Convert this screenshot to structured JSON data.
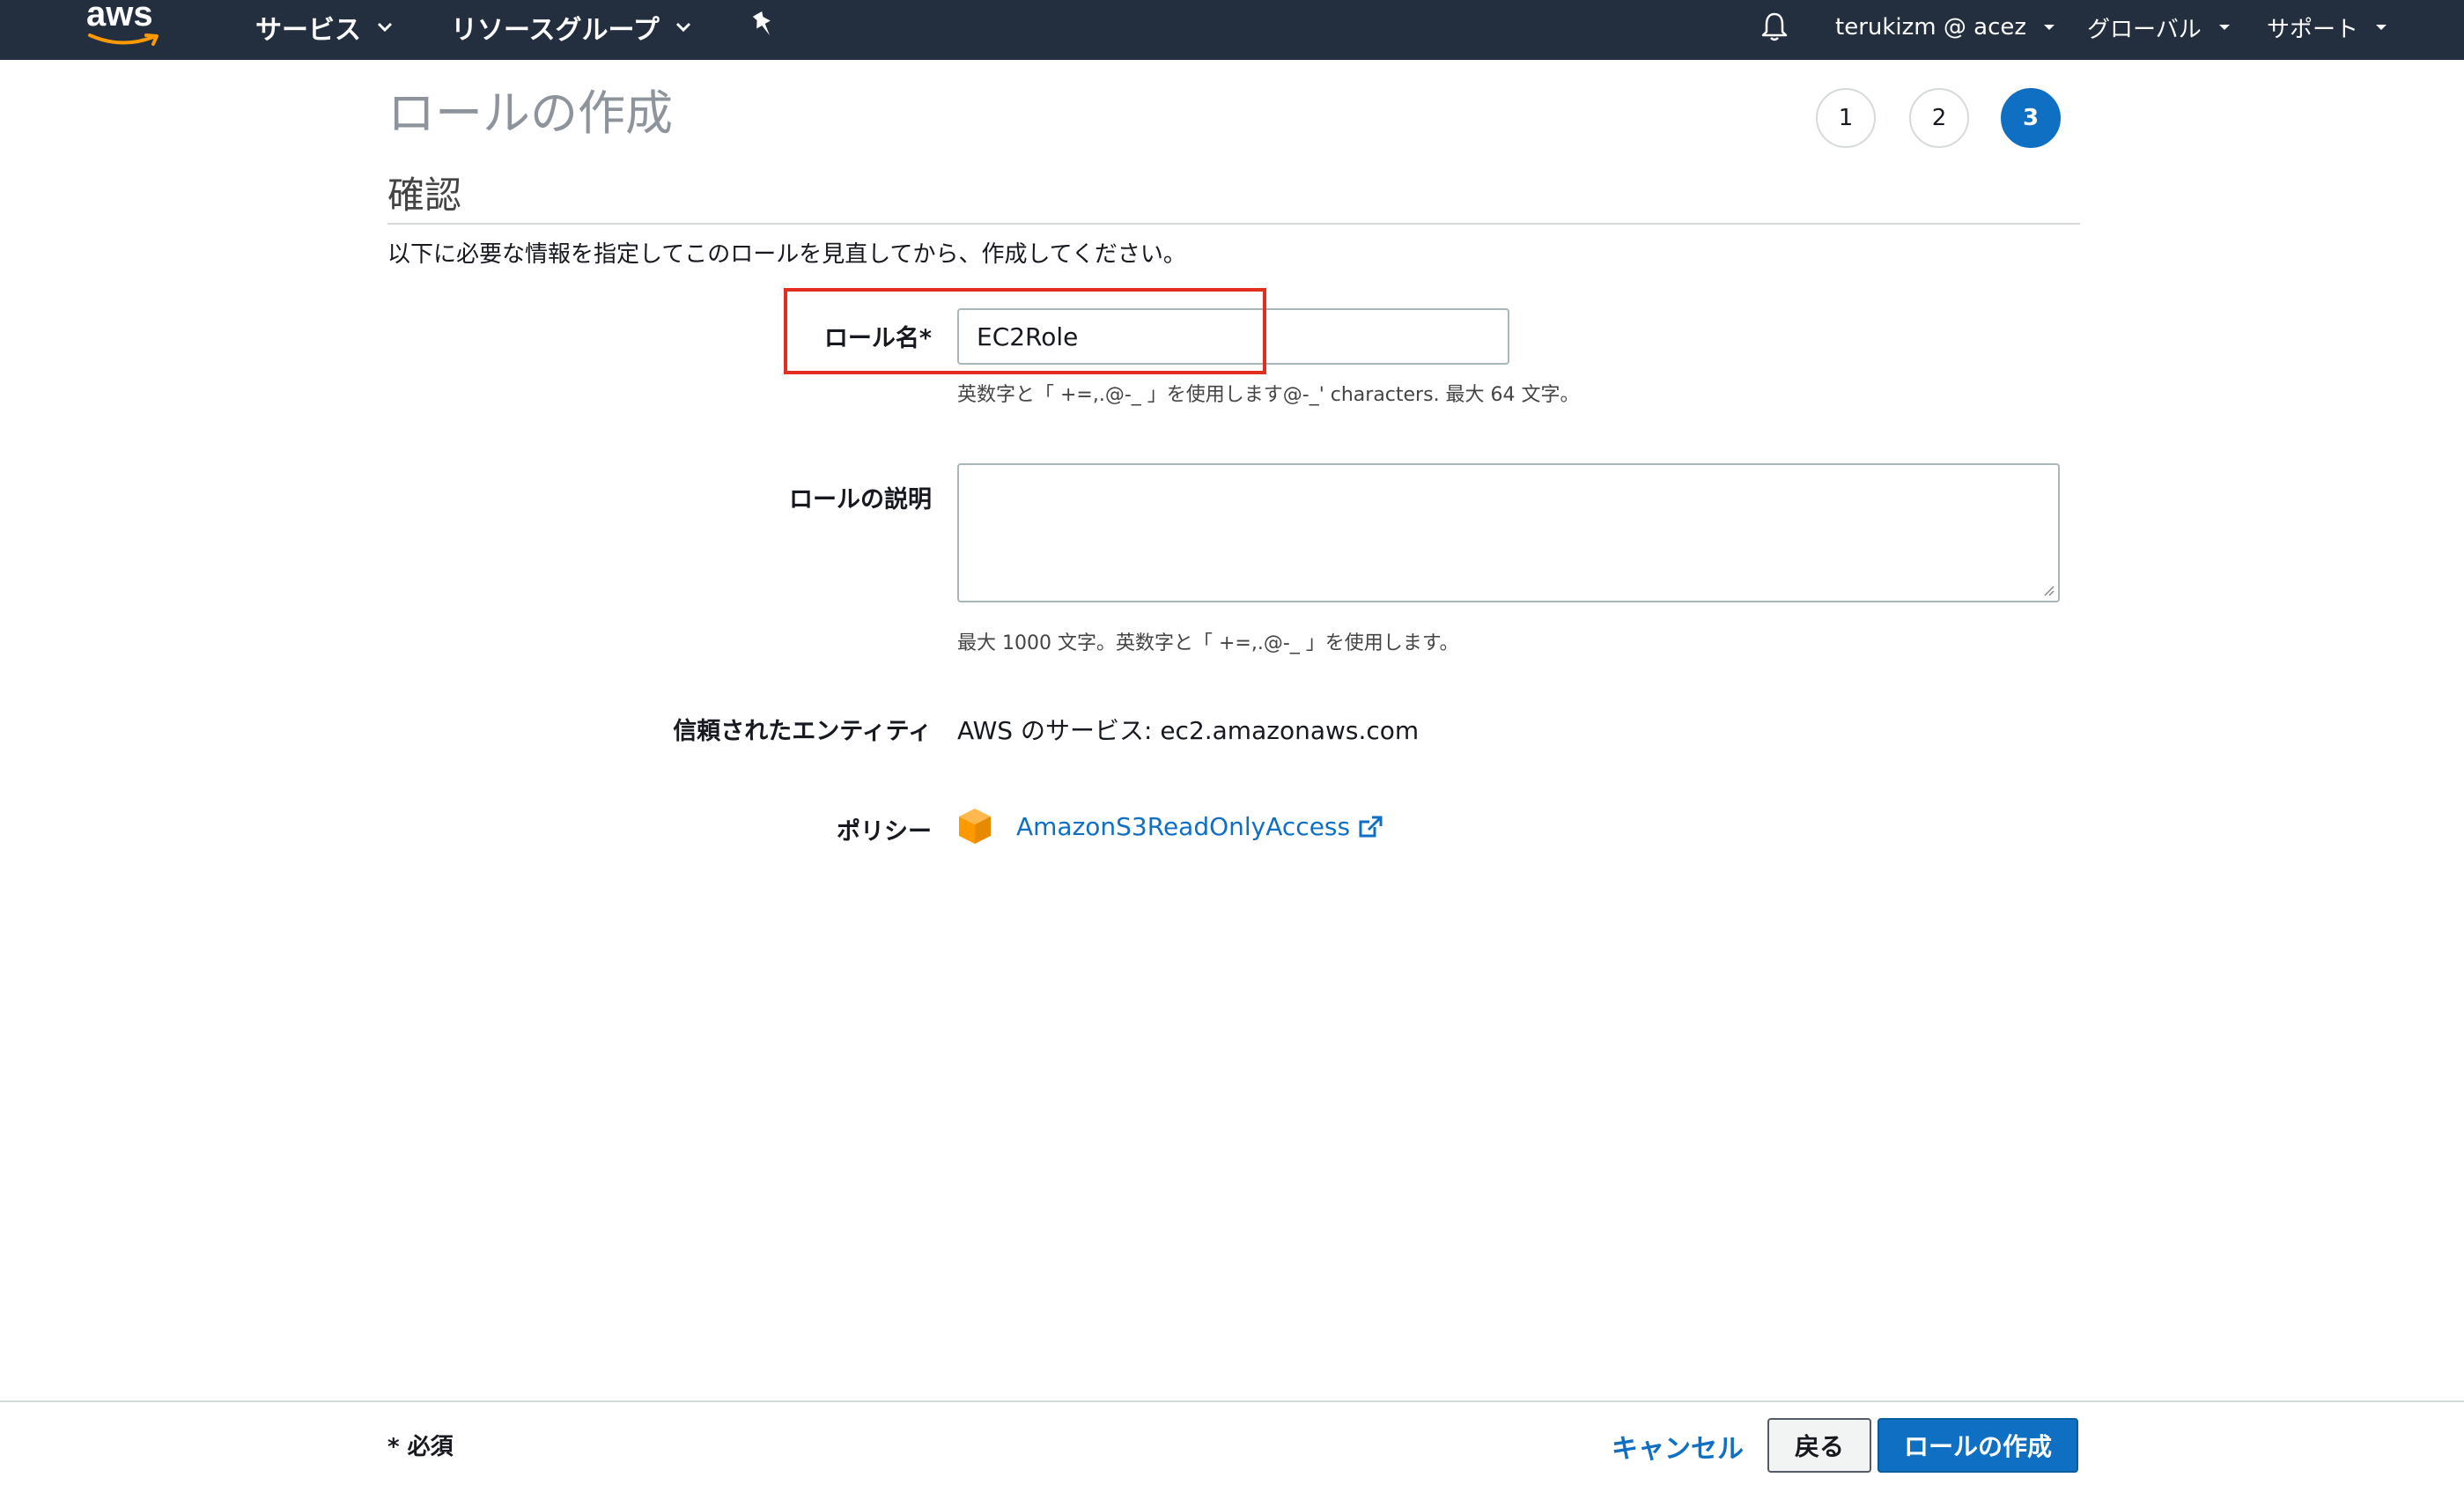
{
  "topnav": {
    "logo": "aws",
    "services_label": "サービス",
    "resource_groups_label": "リソースグループ",
    "account_label": "terukizm @ acez",
    "region_label": "グローバル",
    "support_label": "サポート"
  },
  "header": {
    "title": "ロールの作成",
    "steps": [
      "1",
      "2",
      "3"
    ],
    "active_step": 3
  },
  "section": {
    "title": "確認",
    "intro": "以下に必要な情報を指定してこのロールを見直してから、作成してください。"
  },
  "form": {
    "role_name_label": "ロール名*",
    "role_name_value": "EC2Role",
    "role_name_hint": "英数字と「 +=,.@-_ 」を使用します@-_' characters. 最大 64 文字。",
    "description_label": "ロールの説明",
    "description_value": "",
    "description_hint": "最大 1000 文字。英数字と「 +=,.@-_ 」を使用します。",
    "trusted_label": "信頼されたエンティティ",
    "trusted_value": "AWS のサービス: ec2.amazonaws.com",
    "policy_label": "ポリシー",
    "policy_name": "AmazonS3ReadOnlyAccess"
  },
  "footer": {
    "required_note": "* 必須",
    "cancel_label": "キャンセル",
    "back_label": "戻る",
    "create_label": "ロールの作成"
  },
  "colors": {
    "nav_bg": "#232f3e",
    "primary": "#0e6fc3",
    "highlight": "#e22d21",
    "aws_orange": "#ff9900"
  }
}
